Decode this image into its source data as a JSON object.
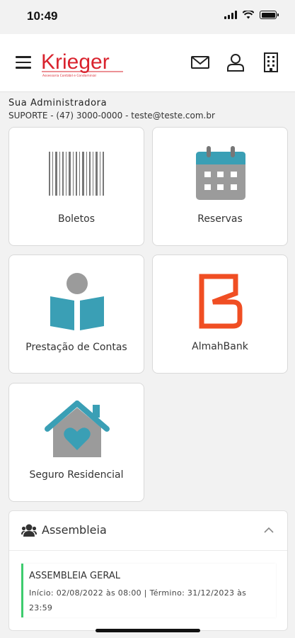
{
  "status_bar": {
    "time": "10:49"
  },
  "header": {
    "logo_text": "Krieger",
    "logo_subtitle": "Assessoria Contábil e Condominial"
  },
  "admin": {
    "title": "Sua Administradora",
    "contact": "SUPORTE - (47) 3000-0000 - teste@teste.com.br"
  },
  "cards": [
    {
      "label": "Boletos",
      "icon": "barcode-icon"
    },
    {
      "label": "Reservas",
      "icon": "calendar-icon"
    },
    {
      "label": "Prestação de Contas",
      "icon": "book-reader-icon"
    },
    {
      "label": "AlmahBank",
      "icon": "almahbank-logo-icon"
    },
    {
      "label": "Seguro Residencial",
      "icon": "house-heart-icon"
    }
  ],
  "assembleia": {
    "title": "Assembleia",
    "items": [
      {
        "title": "ASSEMBLEIA GERAL",
        "dates": "Início: 02/08/2022 às 08:00 | Término: 31/12/2023 às 23:59"
      }
    ]
  },
  "colors": {
    "brand_red": "#d9232e",
    "teal": "#3a9fb5",
    "calendar_gray": "#9b9b9b",
    "almah_orange": "#f04e23",
    "active_green": "#3ecc6e"
  }
}
